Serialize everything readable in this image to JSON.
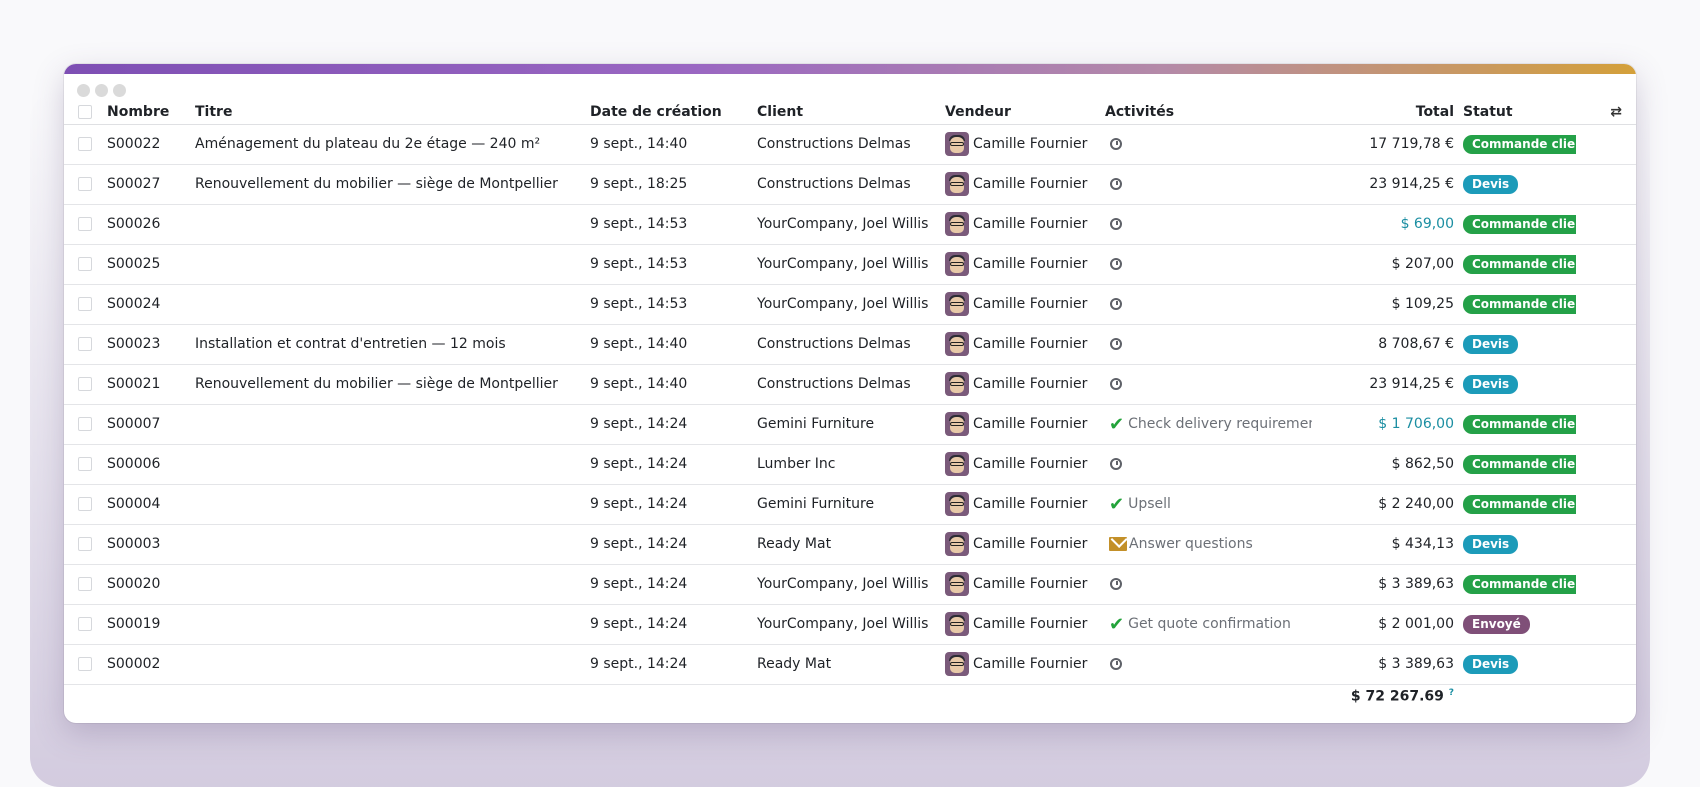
{
  "columns": {
    "nombre": "Nombre",
    "titre": "Titre",
    "date": "Date de création",
    "client": "Client",
    "vendeur": "Vendeur",
    "activites": "Activités",
    "total": "Total",
    "statut": "Statut"
  },
  "colors": {
    "commande": "#24a148",
    "devis": "#1c9bb9",
    "envoye": "#7f4f78",
    "teal_total": "#1b8ea2"
  },
  "rows": [
    {
      "nombre": "S00022",
      "titre": "Aménagement du plateau du 2e étage — 240 m²",
      "date": "9 sept., 14:40",
      "client": "Constructions Delmas",
      "vendeur": "Camille Fournier",
      "activity": {
        "type": "clock",
        "label": ""
      },
      "total": "17 719,78 €",
      "total_color": "default",
      "statut": "Commande client",
      "statut_kind": "commande"
    },
    {
      "nombre": "S00027",
      "titre": "Renouvellement du mobilier — siège de Montpellier",
      "date": "9 sept., 18:25",
      "client": "Constructions Delmas",
      "vendeur": "Camille Fournier",
      "activity": {
        "type": "clock",
        "label": ""
      },
      "total": "23 914,25 €",
      "total_color": "default",
      "statut": "Devis",
      "statut_kind": "devis"
    },
    {
      "nombre": "S00026",
      "titre": "",
      "date": "9 sept., 14:53",
      "client": "YourCompany, Joel Willis",
      "vendeur": "Camille Fournier",
      "activity": {
        "type": "clock",
        "label": ""
      },
      "total": "$ 69,00",
      "total_color": "teal",
      "statut": "Commande client",
      "statut_kind": "commande"
    },
    {
      "nombre": "S00025",
      "titre": "",
      "date": "9 sept., 14:53",
      "client": "YourCompany, Joel Willis",
      "vendeur": "Camille Fournier",
      "activity": {
        "type": "clock",
        "label": ""
      },
      "total": "$ 207,00",
      "total_color": "default",
      "statut": "Commande client",
      "statut_kind": "commande"
    },
    {
      "nombre": "S00024",
      "titre": "",
      "date": "9 sept., 14:53",
      "client": "YourCompany, Joel Willis",
      "vendeur": "Camille Fournier",
      "activity": {
        "type": "clock",
        "label": ""
      },
      "total": "$ 109,25",
      "total_color": "default",
      "statut": "Commande client",
      "statut_kind": "commande"
    },
    {
      "nombre": "S00023",
      "titre": "Installation et contrat d'entretien — 12 mois",
      "date": "9 sept., 14:40",
      "client": "Constructions Delmas",
      "vendeur": "Camille Fournier",
      "activity": {
        "type": "clock",
        "label": ""
      },
      "total": "8 708,67 €",
      "total_color": "default",
      "statut": "Devis",
      "statut_kind": "devis"
    },
    {
      "nombre": "S00021",
      "titre": "Renouvellement du mobilier — siège de Montpellier",
      "date": "9 sept., 14:40",
      "client": "Constructions Delmas",
      "vendeur": "Camille Fournier",
      "activity": {
        "type": "clock",
        "label": ""
      },
      "total": "23 914,25 €",
      "total_color": "default",
      "statut": "Devis",
      "statut_kind": "devis"
    },
    {
      "nombre": "S00007",
      "titre": "",
      "date": "9 sept., 14:24",
      "client": "Gemini Furniture",
      "vendeur": "Camille Fournier",
      "activity": {
        "type": "check",
        "label": "Check delivery requirements"
      },
      "total": "$ 1 706,00",
      "total_color": "teal",
      "statut": "Commande client",
      "statut_kind": "commande"
    },
    {
      "nombre": "S00006",
      "titre": "",
      "date": "9 sept., 14:24",
      "client": "Lumber Inc",
      "vendeur": "Camille Fournier",
      "activity": {
        "type": "clock",
        "label": ""
      },
      "total": "$ 862,50",
      "total_color": "default",
      "statut": "Commande client",
      "statut_kind": "commande"
    },
    {
      "nombre": "S00004",
      "titre": "",
      "date": "9 sept., 14:24",
      "client": "Gemini Furniture",
      "vendeur": "Camille Fournier",
      "activity": {
        "type": "check",
        "label": "Upsell"
      },
      "total": "$ 2 240,00",
      "total_color": "default",
      "statut": "Commande client",
      "statut_kind": "commande"
    },
    {
      "nombre": "S00003",
      "titre": "",
      "date": "9 sept., 14:24",
      "client": "Ready Mat",
      "vendeur": "Camille Fournier",
      "activity": {
        "type": "mail",
        "label": "Answer questions"
      },
      "total": "$ 434,13",
      "total_color": "default",
      "statut": "Devis",
      "statut_kind": "devis"
    },
    {
      "nombre": "S00020",
      "titre": "",
      "date": "9 sept., 14:24",
      "client": "YourCompany, Joel Willis",
      "vendeur": "Camille Fournier",
      "activity": {
        "type": "clock",
        "label": ""
      },
      "total": "$ 3 389,63",
      "total_color": "default",
      "statut": "Commande client",
      "statut_kind": "commande"
    },
    {
      "nombre": "S00019",
      "titre": "",
      "date": "9 sept., 14:24",
      "client": "YourCompany, Joel Willis",
      "vendeur": "Camille Fournier",
      "activity": {
        "type": "check",
        "label": "Get quote confirmation"
      },
      "total": "$ 2 001,00",
      "total_color": "default",
      "statut": "Envoyé",
      "statut_kind": "envoye"
    },
    {
      "nombre": "S00002",
      "titre": "",
      "date": "9 sept., 14:24",
      "client": "Ready Mat",
      "vendeur": "Camille Fournier",
      "activity": {
        "type": "clock",
        "label": ""
      },
      "total": "$ 3 389,63",
      "total_color": "default",
      "statut": "Devis",
      "statut_kind": "devis"
    }
  ],
  "footer": {
    "grand_total": "$ 72 267.69",
    "help_mark": "?"
  }
}
